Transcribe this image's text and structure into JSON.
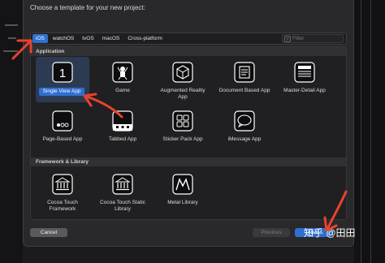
{
  "dialog": {
    "title": "Choose a template for your new project:"
  },
  "tabs": [
    {
      "label": "iOS",
      "active": true
    },
    {
      "label": "watchOS",
      "active": false
    },
    {
      "label": "tvOS",
      "active": false
    },
    {
      "label": "macOS",
      "active": false
    },
    {
      "label": "Cross-platform",
      "active": false
    }
  ],
  "filter": {
    "placeholder": "Filter",
    "icon": "filter-icon"
  },
  "sections": {
    "application": "Application",
    "framework": "Framework & Library"
  },
  "application_templates": [
    {
      "label": "Single View App",
      "icon": "single-view-icon",
      "selected": true
    },
    {
      "label": "Game",
      "icon": "game-icon",
      "selected": false
    },
    {
      "label": "Augmented Reality App",
      "icon": "ar-icon",
      "selected": false
    },
    {
      "label": "Document Based App",
      "icon": "document-icon",
      "selected": false
    },
    {
      "label": "Master-Detail App",
      "icon": "master-detail-icon",
      "selected": false
    },
    {
      "label": "Page-Based App",
      "icon": "page-based-icon",
      "selected": false
    },
    {
      "label": "Tabbed App",
      "icon": "tabbed-icon",
      "selected": false
    },
    {
      "label": "Sticker Pack App",
      "icon": "sticker-pack-icon",
      "selected": false
    },
    {
      "label": "iMessage App",
      "icon": "imessage-icon",
      "selected": false
    }
  ],
  "framework_templates": [
    {
      "label": "Cocoa Touch Framework",
      "icon": "cocoa-framework-icon"
    },
    {
      "label": "Cocoa Touch Static Library",
      "icon": "cocoa-static-library-icon"
    },
    {
      "label": "Metal Library",
      "icon": "metal-library-icon"
    }
  ],
  "buttons": {
    "cancel": "Cancel",
    "previous": "Previous",
    "next": "Next"
  },
  "watermark": "知乎 @田田",
  "colors": {
    "accent": "#2f6fd0",
    "annotation": "#e8432c"
  }
}
